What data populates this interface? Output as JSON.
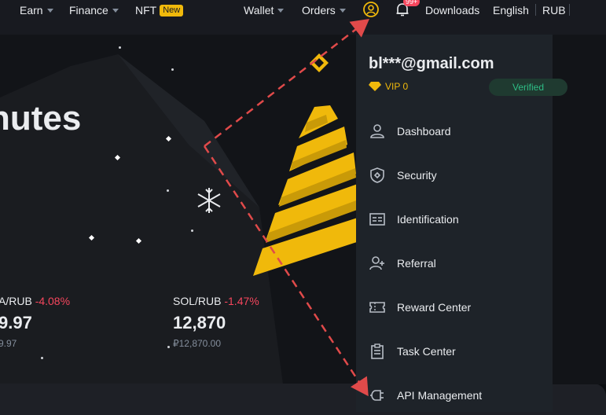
{
  "topnav": {
    "items": [
      {
        "label": "Earn",
        "caret": true
      },
      {
        "label": "Finance",
        "caret": true
      },
      {
        "label": "NFT",
        "badge": "New"
      },
      {
        "label": "Wallet",
        "caret": true
      },
      {
        "label": "Orders",
        "caret": true
      }
    ],
    "notification_badge": "99+",
    "downloads": "Downloads",
    "language": "English",
    "currency": "RUB"
  },
  "hero": {
    "title_fragment": "nutes"
  },
  "tickers": [
    {
      "pair": "A/RUB",
      "change": "-4.08%",
      "price": "9.97",
      "sub": "9.97"
    },
    {
      "pair": "SOL/RUB",
      "change": "-1.47%",
      "price": "12,870",
      "sub": "₽12,870.00"
    }
  ],
  "account_menu": {
    "email": "bl***@gmail.com",
    "vip_label": "VIP 0",
    "status": "Verified",
    "items": [
      {
        "label": "Dashboard",
        "icon": "user-icon"
      },
      {
        "label": "Security",
        "icon": "shield-icon"
      },
      {
        "label": "Identification",
        "icon": "id-card-icon"
      },
      {
        "label": "Referral",
        "icon": "user-plus-icon"
      },
      {
        "label": "Reward Center",
        "icon": "ticket-icon"
      },
      {
        "label": "Task Center",
        "icon": "clipboard-icon"
      },
      {
        "label": "API Management",
        "icon": "plug-icon"
      }
    ]
  },
  "colors": {
    "accent": "#f0b90b",
    "negative": "#f6465d",
    "positive": "#2ebd85",
    "annotation_arrow": "#e04a4a"
  }
}
